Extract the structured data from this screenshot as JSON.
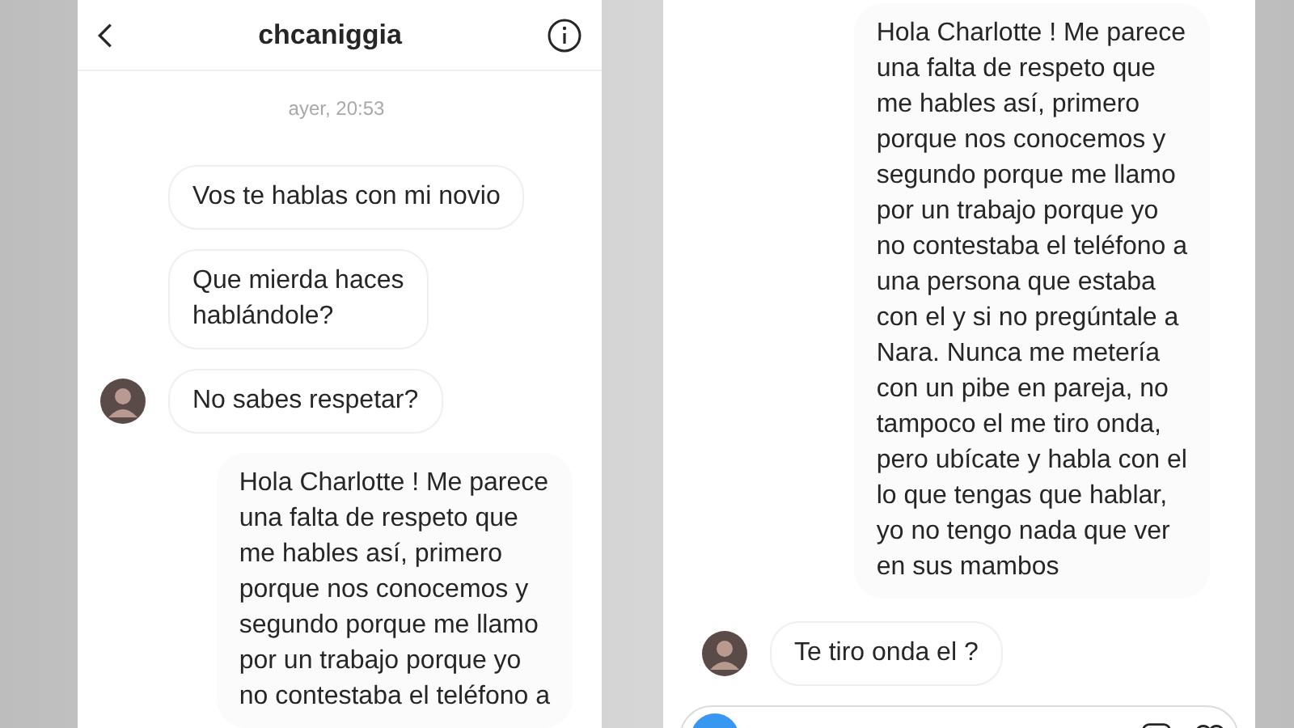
{
  "left_screen": {
    "title": "chcaniggia",
    "messages": [
      {
        "kind": "timestamp",
        "text": "ayer, 20:53"
      },
      {
        "kind": "received",
        "avatar": false,
        "text": "Vos te hablas con mi novio"
      },
      {
        "kind": "received",
        "avatar": false,
        "text": "Que mierda haces\nhablándole?"
      },
      {
        "kind": "received",
        "avatar": true,
        "text": "No sabes respetar?"
      },
      {
        "kind": "sent",
        "text": "Hola Charlotte ! Me parece\nuna falta de respeto que\nme hables así, primero\nporque nos conocemos y\nsegundo porque me llamo\npor un trabajo porque yo\nno contestaba el teléfono a"
      }
    ]
  },
  "right_screen": {
    "composer": true,
    "messages": [
      {
        "kind": "sent",
        "text": "Hola Charlotte ! Me parece\nuna falta de respeto que\nme hables así, primero\nporque nos conocemos y\nsegundo porque me llamo\npor un trabajo porque yo\nno contestaba el teléfono a\nuna persona que estaba\ncon el y si no pregúntale a\nNara. Nunca me metería\ncon un pibe en pareja, no\ntampoco el me tiro onda,\npero ubícate y habla con el\nlo que tengas que hablar,\nyo no tengo nada que ver\nen sus mambos"
      },
      {
        "kind": "received",
        "avatar": true,
        "text": "Te tiro onda el ?"
      }
    ]
  }
}
